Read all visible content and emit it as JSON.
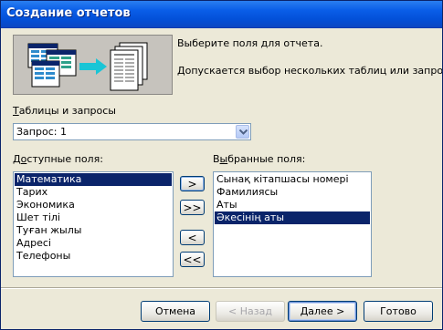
{
  "window": {
    "title": "Создание отчетов"
  },
  "description": {
    "line1": "Выберите поля для отчета.",
    "line2": "Допускается выбор нескольких таблиц или запросов."
  },
  "tables_label": {
    "accel": "Т",
    "rest": "аблицы и запросы"
  },
  "tables_combo": {
    "value": "Запрос: 1",
    "icon": "chevron-down-icon"
  },
  "available_label": {
    "pre": "Д",
    "accel": "о",
    "rest": "ступные поля:"
  },
  "available_fields": [
    {
      "label": "Математика",
      "selected": true
    },
    {
      "label": "Тарих"
    },
    {
      "label": "Экономика"
    },
    {
      "label": "Шет тілі"
    },
    {
      "label": "Туған жылы"
    },
    {
      "label": "Адресі"
    },
    {
      "label": "Телефоны"
    }
  ],
  "selected_label": {
    "pre": "В",
    "accel": "ы",
    "rest": "бранные поля:"
  },
  "selected_fields": [
    {
      "label": "Сынақ кітапшасы номері"
    },
    {
      "label": "Фамилиясы"
    },
    {
      "label": "Аты"
    },
    {
      "label": "Әкесінің аты",
      "selected": true
    }
  ],
  "move_buttons": {
    "add_one": ">",
    "add_all": ">>",
    "remove_one": "<",
    "remove_all": "<<"
  },
  "footer": {
    "cancel": "Отмена",
    "back": "< Назад",
    "next": "Далее >",
    "finish": "Готово"
  }
}
